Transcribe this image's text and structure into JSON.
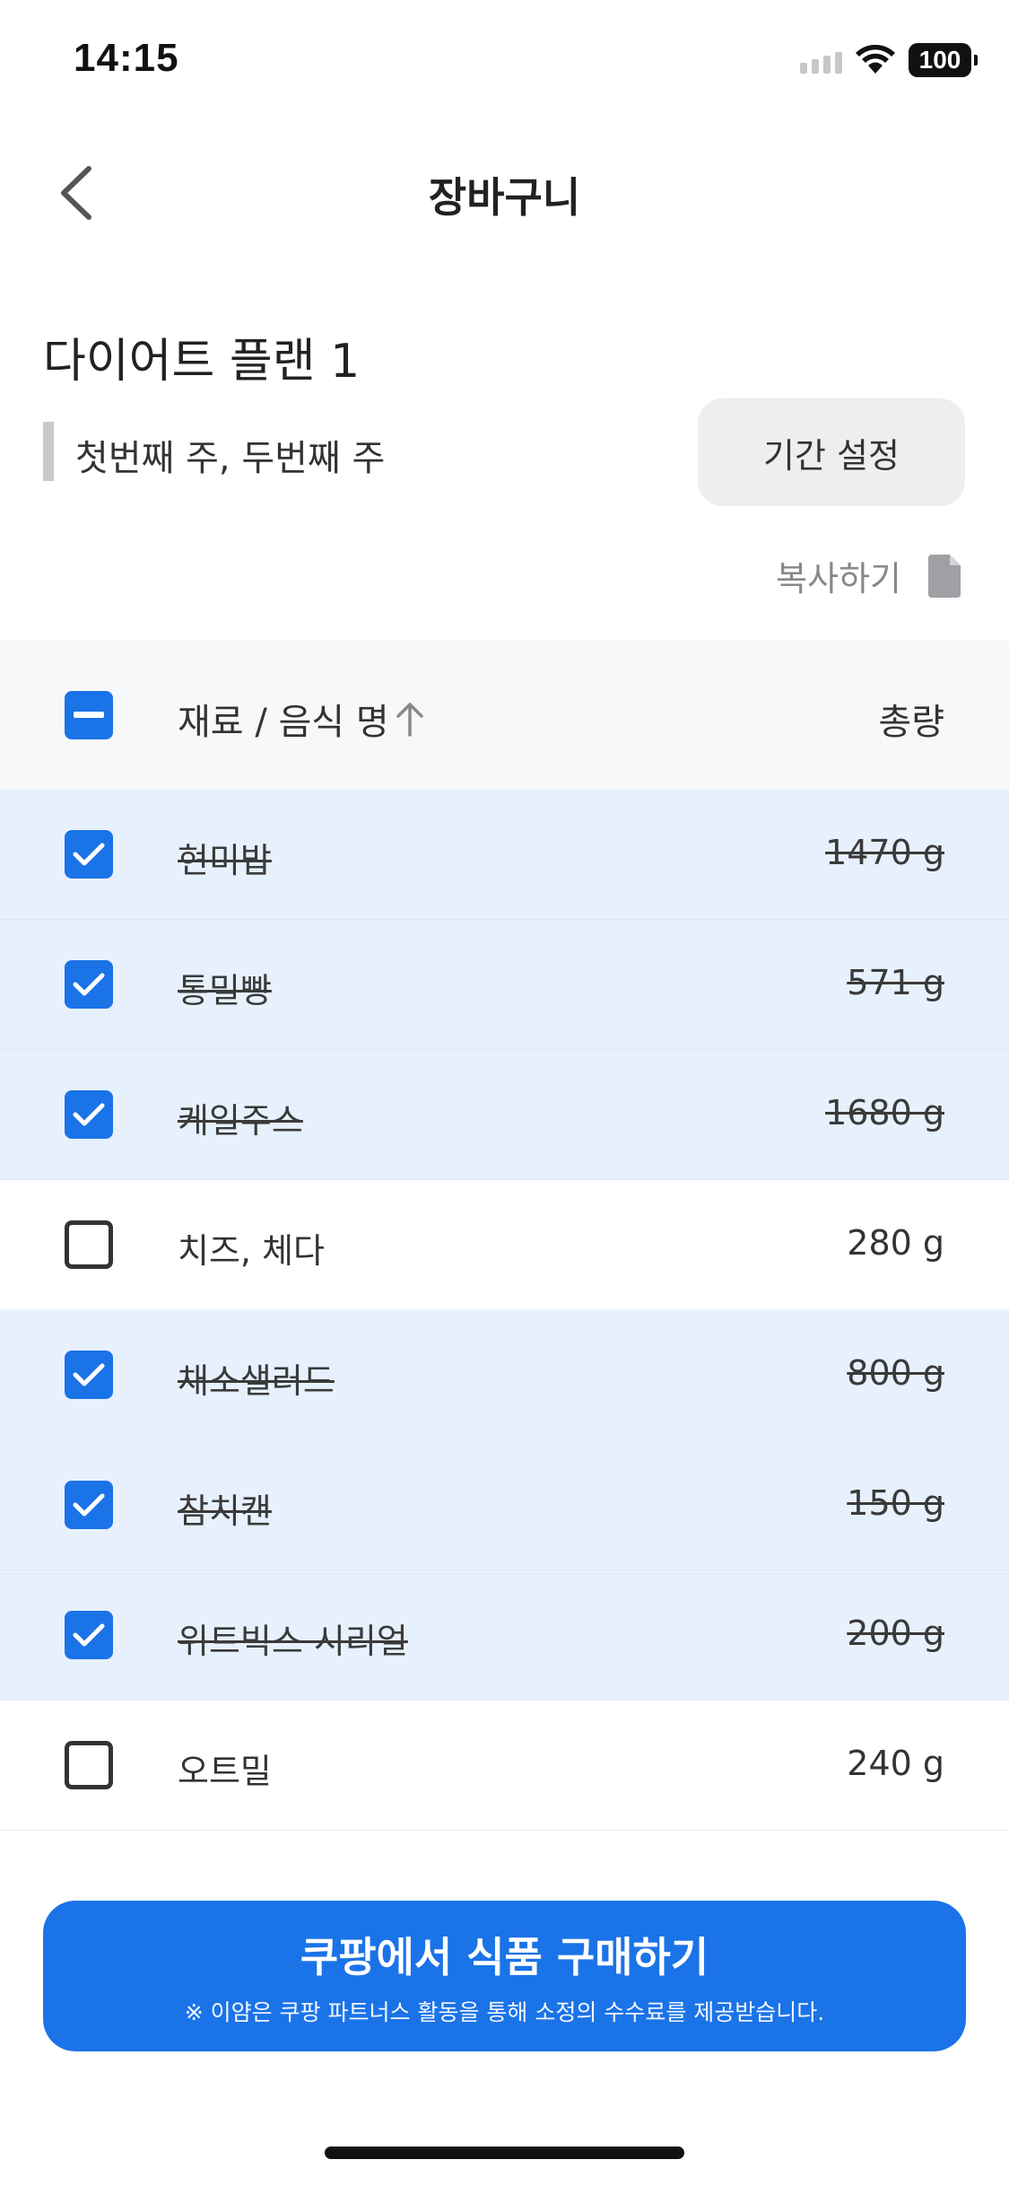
{
  "status_bar": {
    "time": "14:15",
    "battery": "100"
  },
  "nav": {
    "title": "장바구니"
  },
  "plan": {
    "title": "다이어트 플랜 1",
    "period": "첫번째 주, 두번째 주",
    "period_button": "기간 설정",
    "copy_label": "복사하기"
  },
  "table": {
    "header_name": "재료 / 음식 명",
    "header_qty": "총량",
    "rows": [
      {
        "name": "현미밥",
        "qty": "1470 g",
        "checked": true
      },
      {
        "name": "통밀빵",
        "qty": "571 g",
        "checked": true
      },
      {
        "name": "케일주스",
        "qty": "1680 g",
        "checked": true
      },
      {
        "name": "치즈, 체다",
        "qty": "280 g",
        "checked": false
      },
      {
        "name": "채소샐러드",
        "qty": "800 g",
        "checked": true
      },
      {
        "name": "참치캔",
        "qty": "150 g",
        "checked": true
      },
      {
        "name": "위트빅스 시리얼",
        "qty": "200 g",
        "checked": true
      },
      {
        "name": "오트밀",
        "qty": "240 g",
        "checked": false
      }
    ]
  },
  "cta": {
    "title": "쿠팡에서 식품 구매하기",
    "subtitle": "※ 이얌은 쿠팡 파트너스 활동을 통해 소정의 수수료를 제공받습니다."
  },
  "colors": {
    "accent": "#1b73e8",
    "checked_row": "#e7f1fd"
  }
}
